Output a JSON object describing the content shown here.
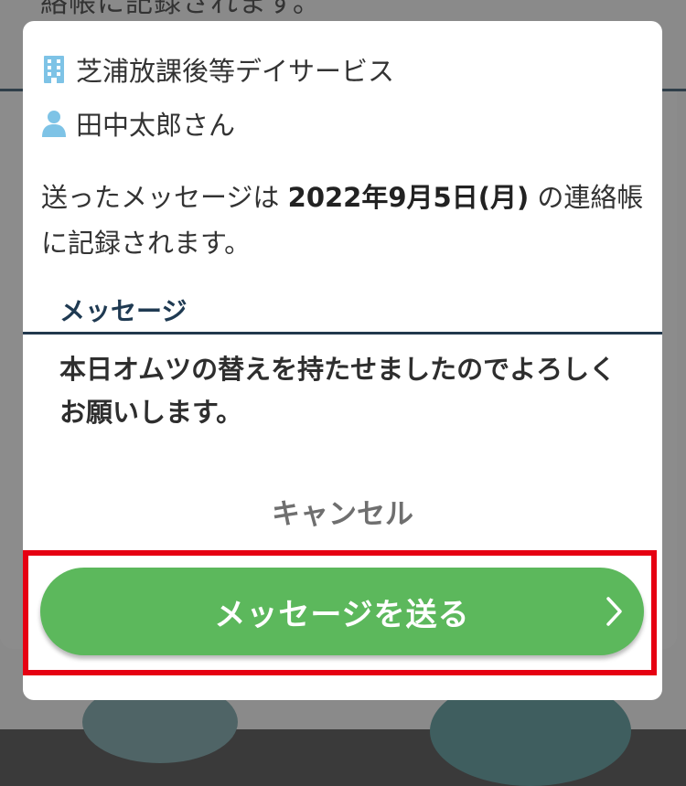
{
  "background": {
    "partial_text": "絡帳に記録されます。"
  },
  "dialog": {
    "facility_name": "芝浦放課後等デイサービス",
    "user_name": "田中太郎さん",
    "notice_prefix": "送ったメッセージは ",
    "notice_date": "2022年9月5日(月)",
    "notice_suffix": " の連絡帳に記録されます。",
    "message_heading": "メッセージ",
    "message_body": "本日オムツの替えを持たせましたのでよろしくお願いします。",
    "cancel_label": "キャンセル",
    "send_label": "メッセージを送る"
  },
  "icons": {
    "facility": "building-icon",
    "user": "person-icon",
    "send": "chevron-right-icon"
  },
  "colors": {
    "primary_button": "#5cb85c",
    "highlight_border": "#e60012",
    "heading": "#1f3a52",
    "icon": "#7ec3e6"
  }
}
